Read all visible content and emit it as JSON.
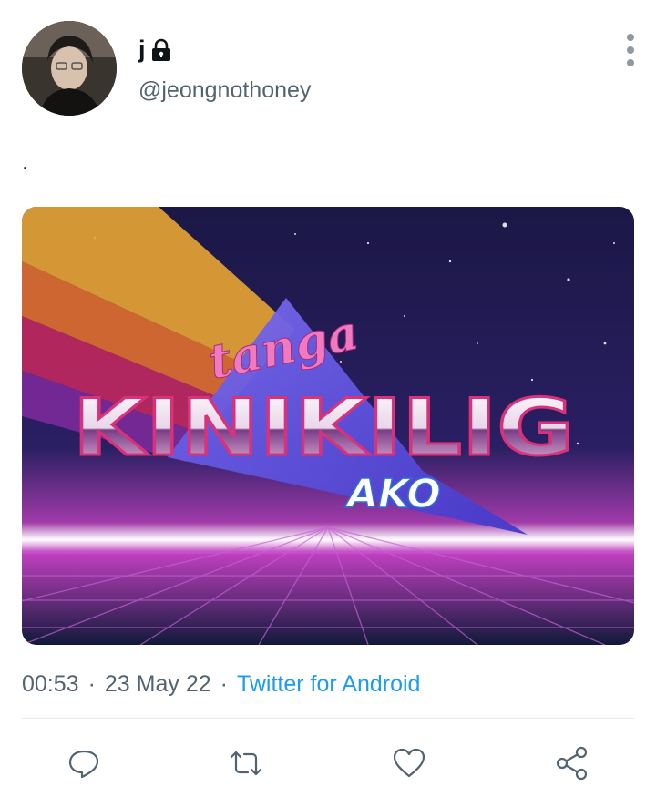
{
  "author": {
    "display_name": "j",
    "handle": "@jeongnothoney",
    "protected_icon": "lock-icon"
  },
  "tweet": {
    "text": ".",
    "media": {
      "line1": "tanga",
      "line2": "KINIKILIG",
      "line3": "AKO"
    },
    "time": "00:53",
    "date": "23 May 22",
    "source": "Twitter for Android",
    "separator": "·"
  },
  "actions": {
    "reply_icon": "reply-icon",
    "retweet_icon": "retweet-icon",
    "like_icon": "heart-icon",
    "share_icon": "share-icon"
  },
  "colors": {
    "accent": "#1d9bf0",
    "muted": "#536471"
  }
}
